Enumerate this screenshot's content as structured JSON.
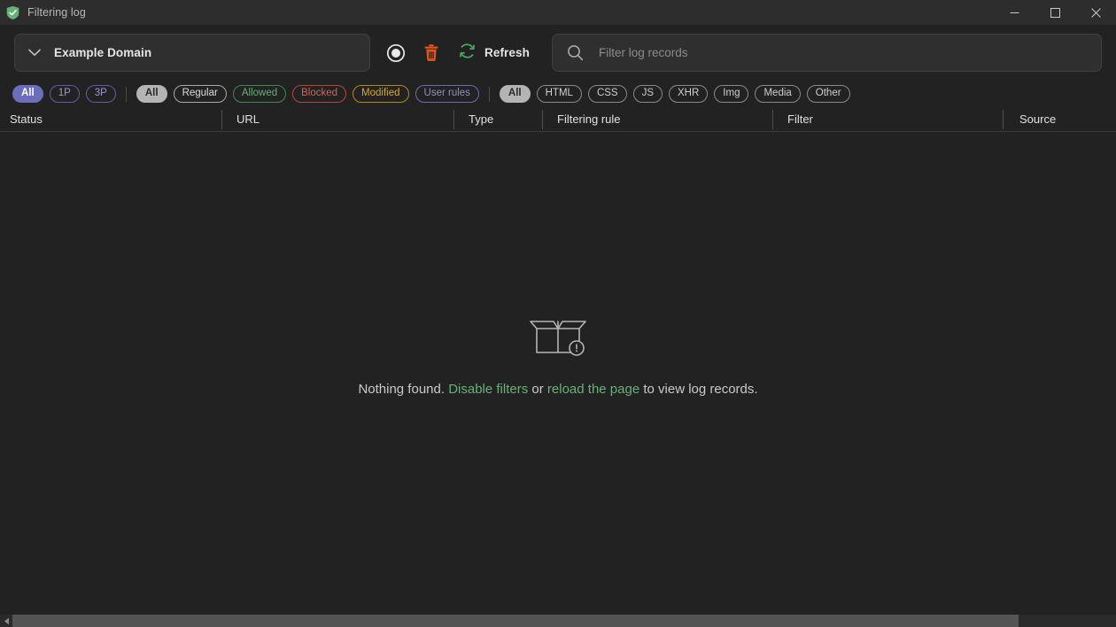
{
  "window": {
    "title": "Filtering log",
    "app_icon": "shield-check-icon",
    "accent_green": "#67b077",
    "background": "#222222",
    "titlebar_background": "#2d2d2d",
    "controls": {
      "minimize": "minimize-icon",
      "maximize": "maximize-icon",
      "close": "close-icon"
    }
  },
  "toolbar": {
    "domain_selector": {
      "value": "Example Domain",
      "chevron": "chevron-down-icon"
    },
    "record_button": {
      "icon": "record-icon",
      "title": "Record"
    },
    "clear_button": {
      "icon": "trash-icon",
      "title": "Clear",
      "color": "#e2561e"
    },
    "refresh_button": {
      "icon": "refresh-icon",
      "label": "Refresh",
      "color": "#4aa85e"
    },
    "search": {
      "icon": "search-icon",
      "placeholder": "Filter log records",
      "value": ""
    }
  },
  "filters": {
    "party_group": [
      {
        "label": "All",
        "style": "sel-purple",
        "selected": true
      },
      {
        "label": "1P",
        "style": "out-purple",
        "selected": false
      },
      {
        "label": "3P",
        "style": "out-purple",
        "selected": false
      }
    ],
    "status_group": [
      {
        "label": "All",
        "style": "sel-gray",
        "selected": true
      },
      {
        "label": "Regular",
        "style": "out-gray",
        "selected": false
      },
      {
        "label": "Allowed",
        "style": "out-green",
        "selected": false
      },
      {
        "label": "Blocked",
        "style": "out-red",
        "selected": false
      },
      {
        "label": "Modified",
        "style": "out-yellow",
        "selected": false
      },
      {
        "label": "User rules",
        "style": "out-violet",
        "selected": false
      }
    ],
    "type_group": [
      {
        "label": "All",
        "style": "sel-gray",
        "selected": true
      },
      {
        "label": "HTML",
        "style": "out-dim",
        "selected": false
      },
      {
        "label": "CSS",
        "style": "out-dim",
        "selected": false
      },
      {
        "label": "JS",
        "style": "out-dim",
        "selected": false
      },
      {
        "label": "XHR",
        "style": "out-dim",
        "selected": false
      },
      {
        "label": "Img",
        "style": "out-dim",
        "selected": false
      },
      {
        "label": "Media",
        "style": "out-dim",
        "selected": false
      },
      {
        "label": "Other",
        "style": "out-dim",
        "selected": false
      }
    ]
  },
  "table": {
    "columns": [
      {
        "key": "status",
        "label": "Status"
      },
      {
        "key": "url",
        "label": "URL"
      },
      {
        "key": "type",
        "label": "Type"
      },
      {
        "key": "rule",
        "label": "Filtering rule"
      },
      {
        "key": "filter",
        "label": "Filter"
      },
      {
        "key": "source",
        "label": "Source"
      }
    ],
    "rows": []
  },
  "empty_state": {
    "icon": "empty-box-icon",
    "text_before": "Nothing found. ",
    "link_disable_filters": "Disable filters",
    "text_middle": " or ",
    "link_reload": "reload the page",
    "text_after": " to view log records."
  },
  "scrollbar": {
    "left_arrow": "arrow-left-icon"
  }
}
